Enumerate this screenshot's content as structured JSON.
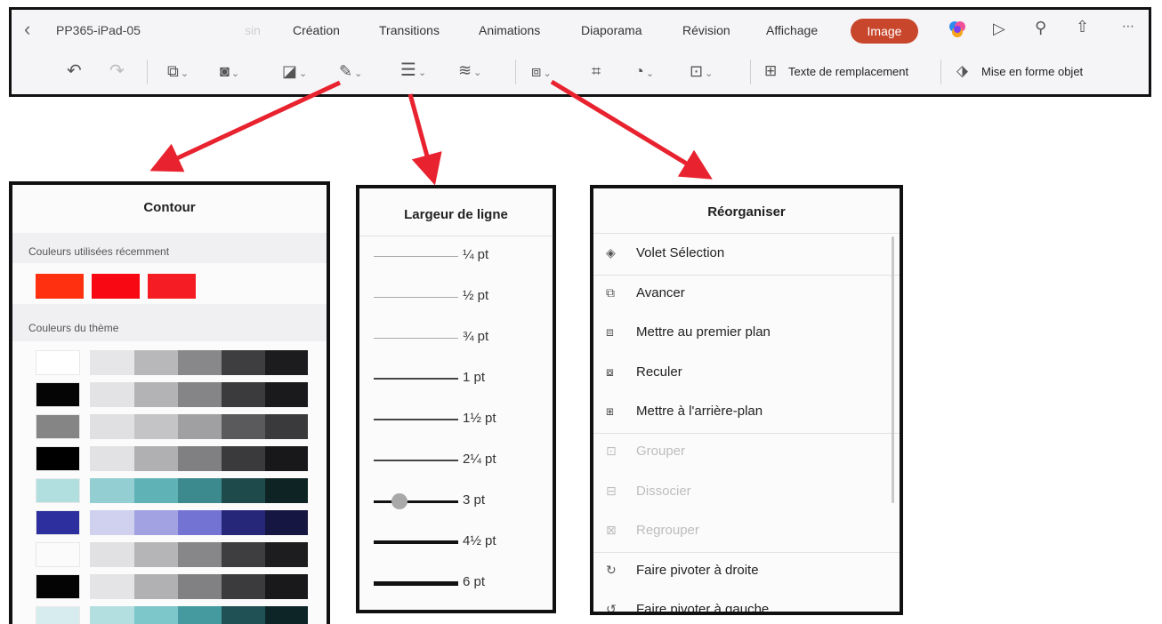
{
  "toolbar": {
    "back_icon": "chevron-left-icon",
    "doc_title": "PP365-iPad-05",
    "ghost_tab": "sin",
    "tabs": [
      "Création",
      "Transitions",
      "Animations",
      "Diaporama",
      "Révision",
      "Affichage"
    ],
    "active_tab": "Image",
    "accent": "#c8462c",
    "alt_text_label": "Texte de remplacement",
    "format_label": "Mise en forme  objet"
  },
  "contour": {
    "title": "Contour",
    "recent_label": "Couleurs utilisées récemment",
    "recent_colors": [
      "#ff3010",
      "#f80812",
      "#f51d23"
    ],
    "theme_label": "Couleurs du thème",
    "theme_rows": [
      [
        "#ffffff",
        "#e6e6e8",
        "#b8b8ba",
        "#88888a",
        "#3e3e40",
        "#1c1c1e"
      ],
      [
        "#050505",
        "#e3e3e5",
        "#b3b3b5",
        "#858587",
        "#3b3b3d",
        "#1a1a1c"
      ],
      [
        "#858585",
        "#e0e0e2",
        "#c4c4c6",
        "#a0a0a2",
        "#5a5a5c",
        "#3a3a3c"
      ],
      [
        "#000000",
        "#e2e2e4",
        "#b0b0b2",
        "#808082",
        "#3a3a3c",
        "#18181a"
      ],
      [
        "#b1dfe0",
        "#93cfd2",
        "#5fb3b7",
        "#3c8a8d",
        "#1e4a4b",
        "#0e2323"
      ],
      [
        "#2e2f9e",
        "#d0d0ef",
        "#a2a2e2",
        "#7373d3",
        "#27277a",
        "#161642"
      ],
      [
        "#fbfbfb",
        "#e1e1e3",
        "#b5b5b7",
        "#878789",
        "#3e3e40",
        "#1d1d1f"
      ],
      [
        "#040404",
        "#e4e4e6",
        "#b1b1b3",
        "#818183",
        "#3b3b3d",
        "#19191b"
      ],
      [
        "#d7ecee",
        "#b3dfe1",
        "#7dc6c9",
        "#449a9e",
        "#205155",
        "#0e2527"
      ]
    ]
  },
  "line_width": {
    "title": "Largeur de ligne",
    "options": [
      "¼ pt",
      "½ pt",
      "¾ pt",
      "1 pt",
      "1½ pt",
      "2¼ pt",
      "3 pt",
      "4½ pt",
      "6 pt"
    ],
    "selected": "3 pt"
  },
  "reorganize": {
    "title": "Réorganiser",
    "items": [
      {
        "label": "Volet Sélection",
        "icon": "layers-icon",
        "enabled": true
      },
      {
        "label": "Avancer",
        "icon": "bring-forward-icon",
        "enabled": true
      },
      {
        "label": "Mettre au premier plan",
        "icon": "bring-to-front-icon",
        "enabled": true
      },
      {
        "label": "Reculer",
        "icon": "send-backward-icon",
        "enabled": true
      },
      {
        "label": "Mettre à l'arrière-plan",
        "icon": "send-to-back-icon",
        "enabled": true
      },
      {
        "label": "Grouper",
        "icon": "group-icon",
        "enabled": false
      },
      {
        "label": "Dissocier",
        "icon": "ungroup-icon",
        "enabled": false
      },
      {
        "label": "Regrouper",
        "icon": "regroup-icon",
        "enabled": false
      },
      {
        "label": "Faire pivoter à droite",
        "icon": "rotate-right-icon",
        "enabled": true
      },
      {
        "label": "Faire pivoter à gauche",
        "icon": "rotate-left-icon",
        "enabled": true
      }
    ]
  },
  "arrow_color": "#e8232f"
}
